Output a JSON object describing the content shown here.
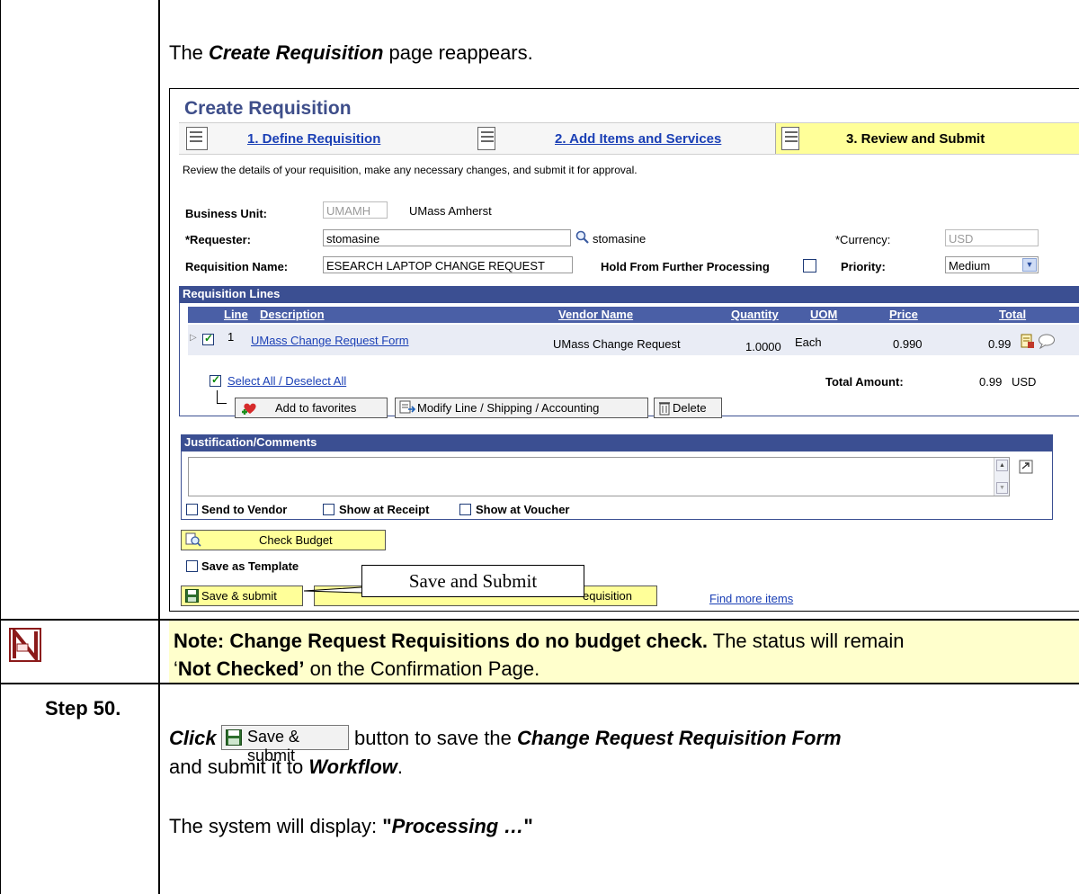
{
  "intro": {
    "prefix": "The ",
    "page_name": "Create Requisition",
    "suffix": " page reappears."
  },
  "screen": {
    "title": "Create Requisition",
    "steps": [
      {
        "label": "1. Define Requisition"
      },
      {
        "label": "2. Add Items and Services"
      },
      {
        "label": "3. Review and Submit"
      }
    ],
    "instructions": "Review the details of your requisition, make any necessary changes, and submit it for approval.",
    "business_unit": {
      "label": "Business Unit:",
      "value": "UMAMH",
      "description": "UMass Amherst"
    },
    "requester": {
      "label": "*Requester:",
      "value": "stomasine",
      "description": "stomasine"
    },
    "currency": {
      "label": "*Currency:",
      "value": "USD"
    },
    "requisition_name": {
      "label": "Requisition Name:",
      "value": "ESEARCH LAPTOP CHANGE REQUEST"
    },
    "hold": {
      "label": "Hold From Further Processing"
    },
    "priority": {
      "label": "Priority:",
      "value": "Medium"
    },
    "lines": {
      "header": "Requisition Lines",
      "columns": [
        "Line",
        "Description",
        "Vendor Name",
        "Quantity",
        "UOM",
        "Price",
        "Total"
      ],
      "rows": [
        {
          "line": "1",
          "description": "UMass Change Request Form",
          "vendor": "UMass Change Request",
          "quantity": "1.0000",
          "uom": "Each",
          "price": "0.990",
          "total": "0.99"
        }
      ],
      "select_all": "Select All / Deselect All",
      "total_label": "Total Amount:",
      "total_value": "0.99",
      "total_currency": "USD",
      "add_favorites": "Add to favorites",
      "modify": "Modify Line / Shipping / Accounting",
      "delete": "Delete"
    },
    "justification": {
      "header": "Justification/Comments",
      "send_vendor": "Send to Vendor",
      "show_receipt": "Show at Receipt",
      "show_voucher": "Show at Voucher"
    },
    "check_budget": "Check Budget",
    "save_template": "Save as Template",
    "save_submit": "Save & submit",
    "requisition_partial": "equisition",
    "find_more": "Find more items",
    "callout": "Save and Submit"
  },
  "note": {
    "bold": "Note:  Change Request Requisitions do no budget check.",
    "rest": "  The status will remain",
    "quote_open": "‘",
    "status": "Not Checked’",
    "tail": " on the Confirmation Page."
  },
  "step": {
    "number": "Step 50.",
    "click": "Click",
    "the": " the ",
    "button_label": "Save & submit",
    "after_button": " button to save the ",
    "form_name": "Change Request Requisition Form",
    "line2_prefix": "and submit it to ",
    "workflow": "Workflow",
    "line2_suffix": ".",
    "display_prefix": "The system will display: ",
    "quote_open": "\"",
    "processing": "Processing …",
    "quote_close": "\""
  }
}
